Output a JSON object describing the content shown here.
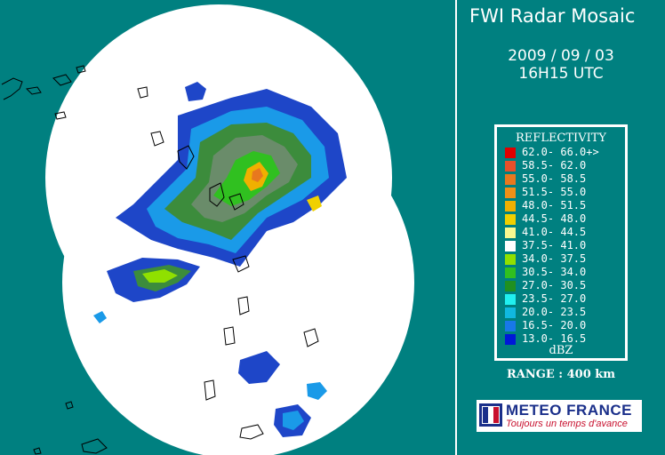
{
  "title": "FWI Radar Mosaic",
  "date": "2009 / 09 / 03",
  "time": "16H15 UTC",
  "legend": {
    "title": "REFLECTIVITY",
    "unit": "dBZ",
    "items": [
      {
        "label": "62.0- 66.0+>",
        "color": "#e00000"
      },
      {
        "label": "58.5- 62.0",
        "color": "#e8502a"
      },
      {
        "label": "55.0- 58.5",
        "color": "#e8781e"
      },
      {
        "label": "51.5- 55.0",
        "color": "#f09018"
      },
      {
        "label": "48.0- 51.5",
        "color": "#f0b000"
      },
      {
        "label": "44.5- 48.0",
        "color": "#f0d000"
      },
      {
        "label": "41.0- 44.5",
        "color": "#f8f890"
      },
      {
        "label": "37.5- 41.0",
        "color": "#ffffff"
      },
      {
        "label": "34.0- 37.5",
        "color": "#90e000"
      },
      {
        "label": "30.5- 34.0",
        "color": "#30c020"
      },
      {
        "label": "27.0- 30.5",
        "color": "#209020"
      },
      {
        "label": "23.5- 27.0",
        "color": "#20f0f0"
      },
      {
        "label": "20.0- 23.5",
        "color": "#10b8e0"
      },
      {
        "label": "16.5- 20.0",
        "color": "#1878e8"
      },
      {
        "label": "13.0- 16.5",
        "color": "#0018d8"
      }
    ]
  },
  "range": "RANGE : 400 km",
  "logo": {
    "name": "METEO FRANCE",
    "tagline": "Toujours un temps d'avance"
  }
}
